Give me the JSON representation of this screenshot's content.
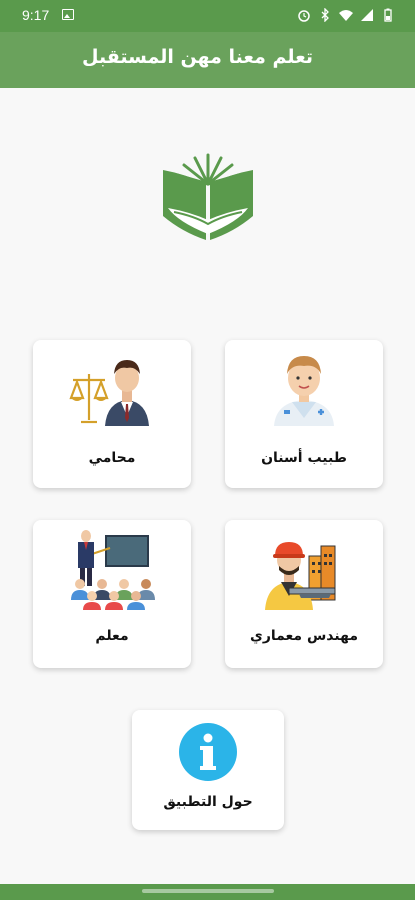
{
  "status_bar": {
    "time": "9:17"
  },
  "app_bar": {
    "title": "تعلم معنا مهن المستقبل"
  },
  "cards": {
    "dentist": {
      "label": "طبيب أسنان"
    },
    "lawyer": {
      "label": "محامي"
    },
    "architect": {
      "label": "مهندس معماري"
    },
    "teacher": {
      "label": "معلم"
    },
    "about": {
      "label": "حول التطبيق"
    }
  },
  "colors": {
    "primary": "#6aa25c",
    "status_bar": "#5a9a4c",
    "info_blue": "#2bb4e8",
    "background": "#f8f8f8"
  }
}
